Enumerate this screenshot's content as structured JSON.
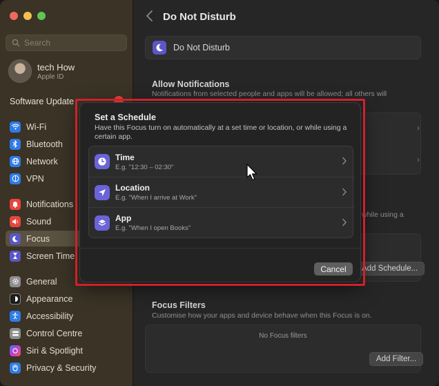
{
  "sidebar": {
    "search_placeholder": "Search",
    "profile": {
      "name": "tech How",
      "subtitle": "Apple ID"
    },
    "software_update": "Software Update",
    "items": [
      {
        "label": "Wi-Fi",
        "icon": "wifi-icon",
        "color": "#2f7be8"
      },
      {
        "label": "Bluetooth",
        "icon": "bluetooth-icon",
        "color": "#2f7be8"
      },
      {
        "label": "Network",
        "icon": "globe-icon",
        "color": "#2f7be8"
      },
      {
        "label": "VPN",
        "icon": "vpn-icon",
        "color": "#2f7be8"
      },
      {
        "label": "Notifications",
        "icon": "bell-icon",
        "color": "#e8453c"
      },
      {
        "label": "Sound",
        "icon": "speaker-icon",
        "color": "#e8453c"
      },
      {
        "label": "Focus",
        "icon": "moon-icon",
        "color": "#5b57c7"
      },
      {
        "label": "Screen Time",
        "icon": "hourglass-icon",
        "color": "#5b57c7"
      },
      {
        "label": "General",
        "icon": "gear-icon",
        "color": "#8e8e8e"
      },
      {
        "label": "Appearance",
        "icon": "appearance-icon",
        "color": "#1a1a1a"
      },
      {
        "label": "Accessibility",
        "icon": "accessibility-icon",
        "color": "#2f7be8"
      },
      {
        "label": "Control Centre",
        "icon": "control-centre-icon",
        "color": "#8e8e8e"
      },
      {
        "label": "Siri & Spotlight",
        "icon": "siri-icon",
        "color": "#b44ad8"
      },
      {
        "label": "Privacy & Security",
        "icon": "hand-icon",
        "color": "#2f7be8"
      }
    ]
  },
  "main": {
    "title": "Do Not Disturb",
    "focus_row_label": "Do Not Disturb",
    "allow_notifications": {
      "title": "Allow Notifications",
      "description": "Notifications from selected people and apps will be allowed; all others will"
    },
    "schedule_fragment": "while using a",
    "add_schedule_button": "Add Schedule...",
    "focus_filters": {
      "title": "Focus Filters",
      "description": "Customise how your apps and device behave when this Focus is on.",
      "empty_text": "No Focus filters",
      "add_filter_button": "Add Filter..."
    }
  },
  "sheet": {
    "title": "Set a Schedule",
    "description": "Have this Focus turn on automatically at a set time or location, or while using a certain app.",
    "options": [
      {
        "label": "Time",
        "example": "E.g. \"12:30 – 02:30\"",
        "icon": "clock-icon"
      },
      {
        "label": "Location",
        "example": "E.g. \"When I arrive at Work\"",
        "icon": "location-arrow-icon"
      },
      {
        "label": "App",
        "example": "E.g. \"When I open Books\"",
        "icon": "app-stack-icon"
      }
    ],
    "cancel_label": "Cancel"
  },
  "colors": {
    "accent_purple": "#6a64d8",
    "highlight_red": "#d21f2b"
  }
}
